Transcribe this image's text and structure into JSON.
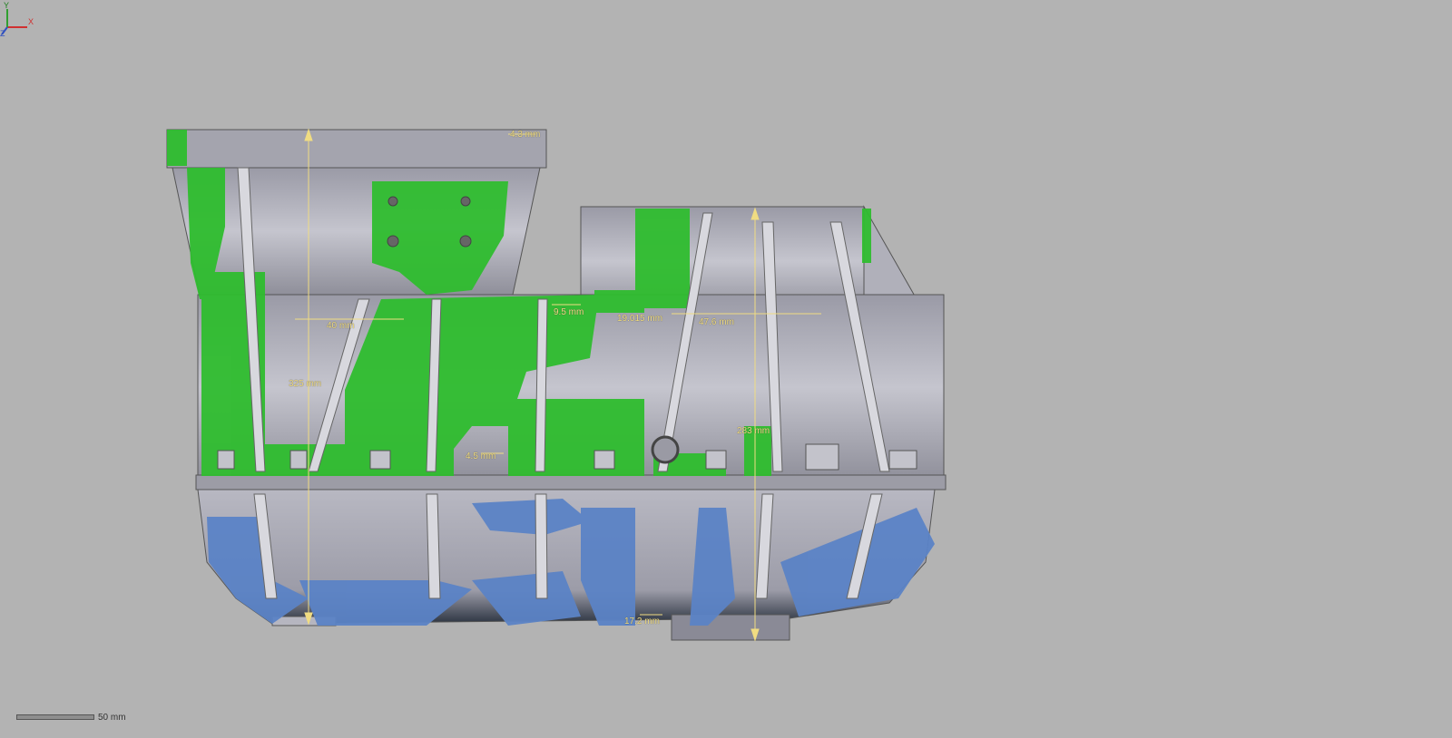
{
  "viewport": {
    "background": "#b3b3b3",
    "model_colors": {
      "body": "#a9a9b4",
      "deviation_positive": "#2fbd2f",
      "deviation_negative": "#5b83c6",
      "dimension": "#f0dc82"
    }
  },
  "dimensions": [
    {
      "id": "d1",
      "text": "4.3 mm"
    },
    {
      "id": "d2",
      "text": "40 mm"
    },
    {
      "id": "d3",
      "text": "325 mm"
    },
    {
      "id": "d4",
      "text": "9.5 mm"
    },
    {
      "id": "d5",
      "text": "19.015 mm"
    },
    {
      "id": "d6",
      "text": "47.6 mm"
    },
    {
      "id": "d7",
      "text": "283 mm"
    },
    {
      "id": "d8",
      "text": "4.5 mm"
    },
    {
      "id": "d9",
      "text": "17.2 mm"
    }
  ],
  "axis_triad": {
    "x": "X",
    "y": "Y",
    "z": "Z"
  },
  "scale": {
    "label": "50 mm"
  }
}
